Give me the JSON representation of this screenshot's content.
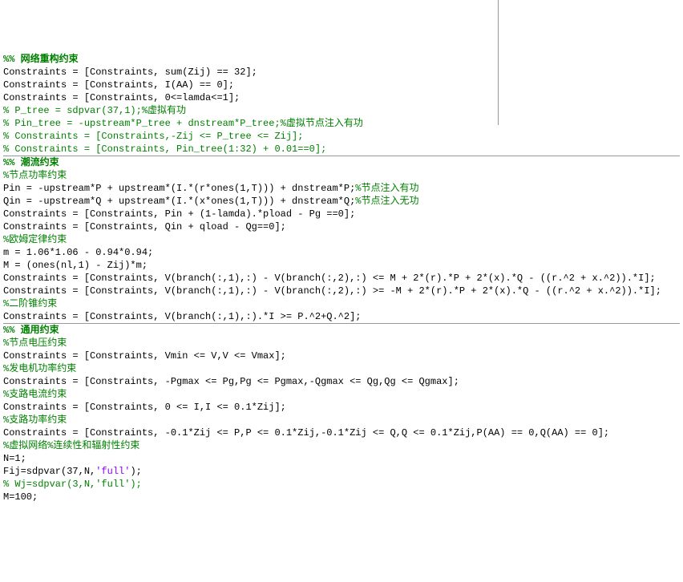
{
  "lines": [
    {
      "spans": [
        {
          "cls": "section-header",
          "t": "%% 网络重构约束"
        }
      ]
    },
    {
      "spans": [
        {
          "cls": "normal",
          "t": "Constraints = [Constraints, sum(Zij) == 32];"
        }
      ]
    },
    {
      "spans": [
        {
          "cls": "normal",
          "t": "Constraints = [Constraints, I(AA) == 0];"
        }
      ]
    },
    {
      "spans": [
        {
          "cls": "normal",
          "t": "Constraints = [Constraints, 0<=lamda<=1];"
        }
      ]
    },
    {
      "spans": [
        {
          "cls": "comment",
          "t": "% P_tree = sdpvar(37,1);%虚拟有功"
        }
      ]
    },
    {
      "spans": [
        {
          "cls": "comment",
          "t": "% Pin_tree = -upstream*P_tree + dnstream*P_tree;%虚拟节点注入有功"
        }
      ]
    },
    {
      "spans": [
        {
          "cls": "comment",
          "t": "% Constraints = [Constraints,-Zij <= P_tree <= Zij];"
        }
      ]
    },
    {
      "spans": [
        {
          "cls": "comment",
          "t": "% Constraints = [Constraints, Pin_tree(1:32) + 0.01==0];"
        }
      ]
    },
    {
      "hr": true
    },
    {
      "spans": [
        {
          "cls": "section-header",
          "t": "%% 潮流约束"
        }
      ]
    },
    {
      "spans": [
        {
          "cls": "comment",
          "t": "%节点功率约束"
        }
      ]
    },
    {
      "spans": [
        {
          "cls": "normal",
          "t": "Pin = -upstream*P + upstream*(I.*(r*ones(1,T))) + dnstream*P;"
        },
        {
          "cls": "comment",
          "t": "%节点注入有功"
        }
      ]
    },
    {
      "spans": [
        {
          "cls": "normal",
          "t": "Qin = -upstream*Q + upstream*(I.*(x*ones(1,T))) + dnstream*Q;"
        },
        {
          "cls": "comment",
          "t": "%节点注入无功"
        }
      ]
    },
    {
      "spans": [
        {
          "cls": "normal",
          "t": "Constraints = [Constraints, Pin + (1-lamda).*pload - Pg ==0];"
        }
      ]
    },
    {
      "spans": [
        {
          "cls": "normal",
          "t": "Constraints = [Constraints, Qin + qload - Qg==0];"
        }
      ]
    },
    {
      "spans": [
        {
          "cls": "comment",
          "t": "%欧姆定律约束"
        }
      ]
    },
    {
      "spans": [
        {
          "cls": "normal",
          "t": "m = 1.06*1.06 - 0.94*0.94;"
        }
      ]
    },
    {
      "spans": [
        {
          "cls": "normal",
          "t": "M = (ones(nl,1) - Zij)*m;"
        }
      ]
    },
    {
      "spans": [
        {
          "cls": "normal",
          "t": "Constraints = [Constraints, V(branch(:,1),:) - V(branch(:,2),:) <= M + 2*(r).*P + 2*(x).*Q - ((r.^2 + x.^2)).*I];"
        }
      ]
    },
    {
      "spans": [
        {
          "cls": "normal",
          "t": "Constraints = [Constraints, V(branch(:,1),:) - V(branch(:,2),:) >= -M + 2*(r).*P + 2*(x).*Q - ((r.^2 + x.^2)).*I];"
        }
      ]
    },
    {
      "spans": [
        {
          "cls": "comment",
          "t": "%二阶锥约束"
        }
      ]
    },
    {
      "spans": [
        {
          "cls": "normal",
          "t": "Constraints = [Constraints, V(branch(:,1),:).*I >= P.^2+Q.^2];"
        }
      ]
    },
    {
      "hr": true
    },
    {
      "spans": [
        {
          "cls": "section-header",
          "t": "%% 通用约束"
        }
      ]
    },
    {
      "spans": [
        {
          "cls": "comment",
          "t": "%节点电压约束"
        }
      ]
    },
    {
      "spans": [
        {
          "cls": "normal",
          "t": "Constraints = [Constraints, Vmin <= V,V <= Vmax];"
        }
      ]
    },
    {
      "spans": [
        {
          "cls": "comment",
          "t": "%发电机功率约束"
        }
      ]
    },
    {
      "spans": [
        {
          "cls": "normal",
          "t": "Constraints = [Constraints, -Pgmax <= Pg,Pg <= Pgmax,-Qgmax <= Qg,Qg <= Qgmax];"
        }
      ]
    },
    {
      "spans": [
        {
          "cls": "comment",
          "t": "%支路电流约束"
        }
      ]
    },
    {
      "spans": [
        {
          "cls": "normal",
          "t": "Constraints = [Constraints, 0 <= I,I <= 0.1*Zij];"
        }
      ]
    },
    {
      "spans": [
        {
          "cls": "comment",
          "t": "%支路功率约束"
        }
      ]
    },
    {
      "spans": [
        {
          "cls": "normal",
          "t": "Constraints = [Constraints, -0.1*Zij <= P,P <= 0.1*Zij,-0.1*Zij <= Q,Q <= 0.1*Zij,P(AA) == 0,Q(AA) == 0];"
        }
      ]
    },
    {
      "spans": [
        {
          "cls": "comment",
          "t": "%虚拟网络%连续性和辐射性约束"
        }
      ]
    },
    {
      "spans": [
        {
          "cls": "normal",
          "t": "N=1;"
        }
      ]
    },
    {
      "spans": [
        {
          "cls": "normal",
          "t": "Fij=sdpvar(37,N,"
        },
        {
          "cls": "string",
          "t": "'full'"
        },
        {
          "cls": "normal",
          "t": ");"
        }
      ]
    },
    {
      "spans": [
        {
          "cls": "comment",
          "t": "% Wj=sdpvar(3,N,'full');"
        }
      ]
    },
    {
      "spans": [
        {
          "cls": "normal",
          "t": "M=100;"
        }
      ]
    }
  ]
}
